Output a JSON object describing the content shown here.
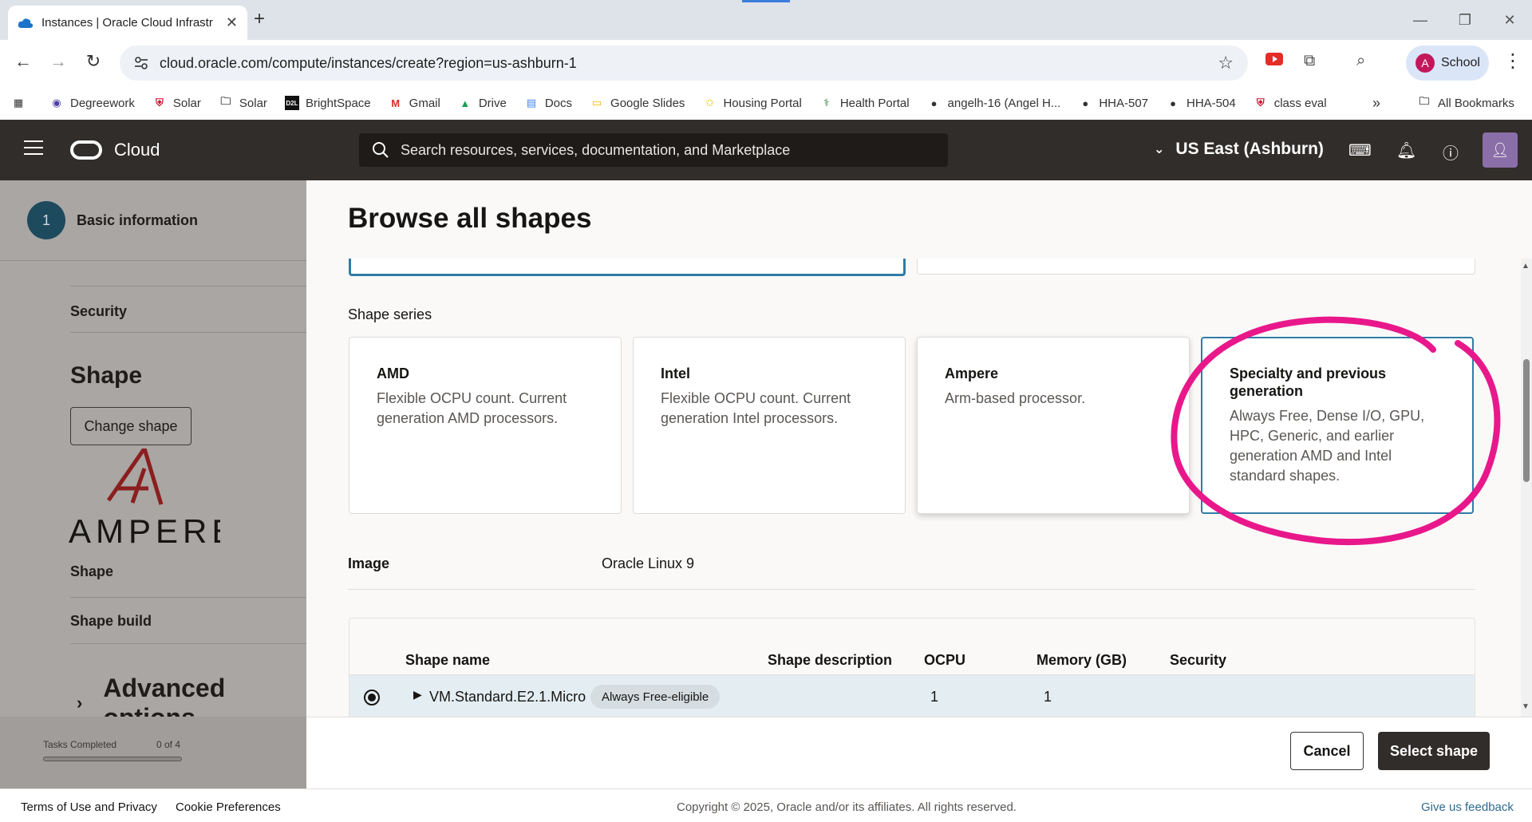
{
  "browser": {
    "tab_title": "Instances | Oracle Cloud Infrastr",
    "url": "cloud.oracle.com/compute/instances/create?region=us-ashburn-1",
    "profile_initial": "A",
    "profile_name": "School",
    "bookmarks": [
      {
        "label": "Degreework",
        "icon": "degreework-icon"
      },
      {
        "label": "Solar",
        "icon": "shield-icon"
      },
      {
        "label": "Solar",
        "icon": "folder-icon"
      },
      {
        "label": "BrightSpace",
        "icon": "d2l-icon"
      },
      {
        "label": "Gmail",
        "icon": "gmail-icon"
      },
      {
        "label": "Drive",
        "icon": "drive-icon"
      },
      {
        "label": "Docs",
        "icon": "docs-icon"
      },
      {
        "label": "Google Slides",
        "icon": "slides-icon"
      },
      {
        "label": "Housing Portal",
        "icon": "star-icon"
      },
      {
        "label": "Health Portal",
        "icon": "health-icon"
      },
      {
        "label": "angelh-16 (Angel H...",
        "icon": "github-icon"
      },
      {
        "label": "HHA-507",
        "icon": "github-icon"
      },
      {
        "label": "HHA-504",
        "icon": "github-icon"
      },
      {
        "label": "class eval",
        "icon": "shield-icon"
      }
    ],
    "all_bookmarks": "All Bookmarks"
  },
  "oci_header": {
    "brand": "Cloud",
    "search_placeholder": "Search resources, services, documentation, and Marketplace",
    "region": "US East (Ashburn)"
  },
  "left_page": {
    "step_number": "1",
    "step_label": "Basic information",
    "security": "Security",
    "shape_title": "Shape",
    "change_shape": "Change shape",
    "logo_text": "AMPERE",
    "shape_label": "Shape",
    "shape_build": "Shape build",
    "advanced": "Advanced options",
    "tasks_label": "Tasks Completed",
    "tasks_count": "0 of 4",
    "tasks_progress": 0
  },
  "panel": {
    "title": "Browse all shapes",
    "series_label": "Shape series",
    "cards": [
      {
        "title": "AMD",
        "desc": "Flexible OCPU count. Current generation AMD processors."
      },
      {
        "title": "Intel",
        "desc": "Flexible OCPU count. Current generation Intel processors."
      },
      {
        "title": "Ampere",
        "desc": "Arm-based processor."
      },
      {
        "title": "Specialty and previous generation",
        "desc": "Always Free, Dense I/O, GPU, HPC, Generic, and earlier generation AMD and Intel standard shapes."
      }
    ],
    "image_label": "Image",
    "image_value": "Oracle Linux 9",
    "table_headers": [
      "Shape name",
      "Shape description",
      "OCPU",
      "Memory (GB)",
      "Security"
    ],
    "row": {
      "name": "VM.Standard.E2.1.Micro",
      "badge": "Always Free-eligible",
      "ocpu": "1",
      "memory": "1"
    },
    "cancel": "Cancel",
    "select": "Select shape"
  },
  "footer": {
    "terms": "Terms of Use and Privacy",
    "cookies": "Cookie Preferences",
    "copyright": "Copyright © 2025, Oracle and/or its affiliates. All rights reserved.",
    "feedback": "Give us feedback"
  },
  "colors": {
    "oci_header": "#312d2a",
    "selected_border": "#2f7ca6",
    "annotation": "#e8188b"
  }
}
